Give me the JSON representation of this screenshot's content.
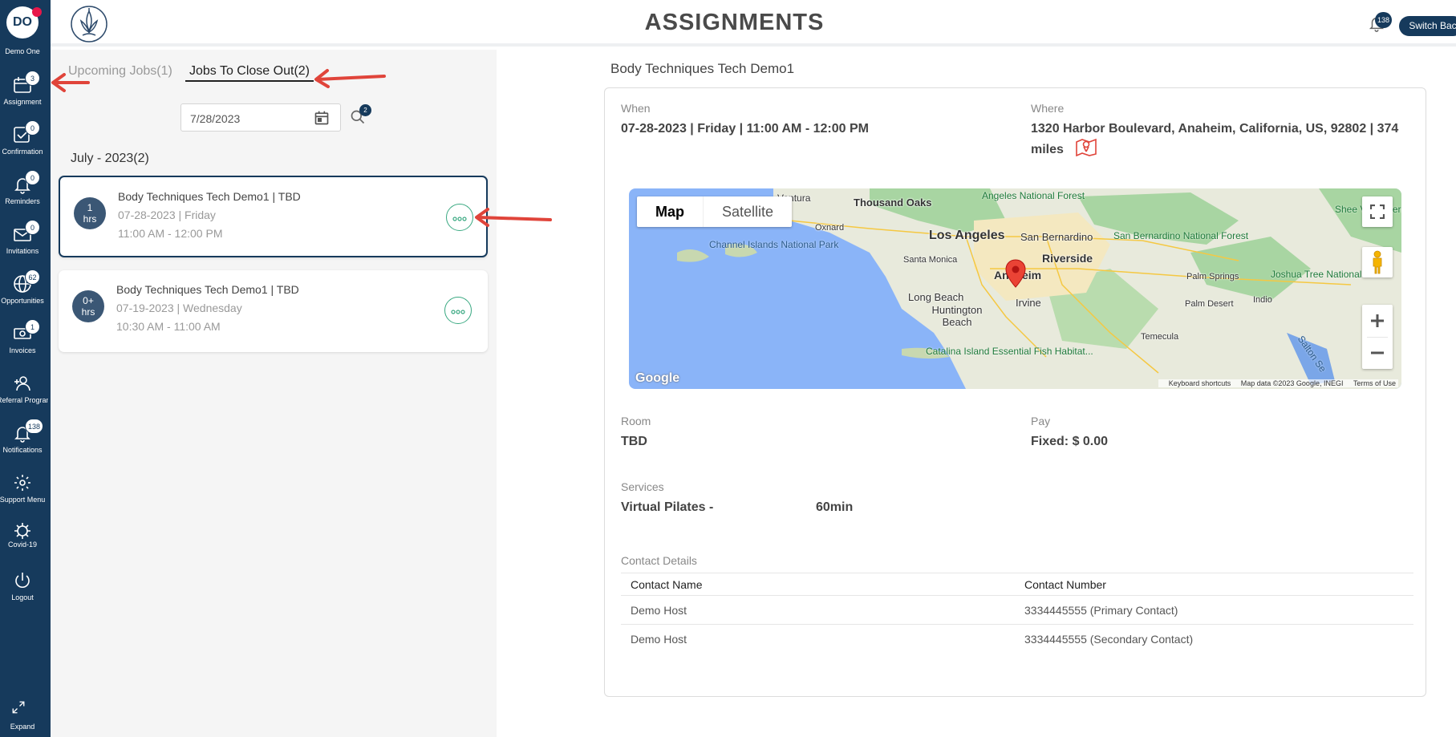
{
  "sidebar": {
    "avatar_initials": "DO",
    "user_name": "Demo One",
    "items": [
      {
        "label": "Assignment",
        "badge": "3",
        "icon": "calendar-icon"
      },
      {
        "label": "Confirmation",
        "badge": "0",
        "icon": "checkbox-icon"
      },
      {
        "label": "Reminders",
        "badge": "0",
        "icon": "bell-icon"
      },
      {
        "label": "Invitations",
        "badge": "0",
        "icon": "envelope-icon"
      },
      {
        "label": "Opportunities",
        "badge": "62",
        "icon": "globe-icon"
      },
      {
        "label": "Invoices",
        "badge": "1",
        "icon": "money-icon"
      },
      {
        "label": "Referral Program",
        "badge": "",
        "icon": "add-user-icon"
      },
      {
        "label": "Notifications",
        "badge": "138",
        "icon": "bell-icon"
      },
      {
        "label": "Support Menu",
        "badge": "",
        "icon": "gear-icon"
      },
      {
        "label": "Covid-19",
        "badge": "",
        "icon": "virus-icon"
      },
      {
        "label": "Logout",
        "badge": "",
        "icon": "power-icon"
      }
    ],
    "expand_label": "Expand"
  },
  "header": {
    "title": "ASSIGNMENTS",
    "notification_count": "138",
    "switch_back_label": "Switch Back"
  },
  "jobs_panel": {
    "tabs": [
      {
        "label": "Upcoming Jobs(1)",
        "active": false
      },
      {
        "label": "Jobs To Close Out(2)",
        "active": true
      }
    ],
    "date_filter": "7/28/2023",
    "search_badge": "2",
    "month_heading": "July - 2023(2)",
    "jobs": [
      {
        "duration_top": "1",
        "duration_bottom": "hrs",
        "title": "Body Techniques Tech Demo1 | TBD",
        "date": "07-28-2023 | Friday",
        "time": "11:00 AM - 12:00 PM",
        "selected": true
      },
      {
        "duration_top": "0+",
        "duration_bottom": "hrs",
        "title": "Body Techniques Tech Demo1 | TBD",
        "date": "07-19-2023 | Wednesday",
        "time": "10:30 AM - 11:00 AM",
        "selected": false
      }
    ]
  },
  "detail": {
    "title": "Body Techniques Tech Demo1",
    "when_label": "When",
    "when_value": "07-28-2023 | Friday | 11:00 AM - 12:00 PM",
    "where_label": "Where",
    "where_value": "1320 Harbor Boulevard, Anaheim, California, US, 92802 | 374 miles",
    "room_label": "Room",
    "room_value": "TBD",
    "pay_label": "Pay",
    "pay_value": "Fixed: $ 0.00",
    "services_label": "Services",
    "service_name": "Virtual Pilates -",
    "service_duration": "60min",
    "contact_label": "Contact Details",
    "contact_headers": [
      "Contact Name",
      "Contact Number"
    ],
    "contacts": [
      {
        "name": "Demo Host",
        "number": "3334445555 (Primary Contact)"
      },
      {
        "name": "Demo Host",
        "number": "3334445555 (Secondary Contact)"
      }
    ]
  },
  "map": {
    "type_options": [
      "Map",
      "Satellite"
    ],
    "selected_type": "Map",
    "footer": [
      "Keyboard shortcuts",
      "Map data ©2023 Google, INEGI",
      "Terms of Use"
    ],
    "logo_text": "Google",
    "places": {
      "ventura": "Ventura",
      "thousand_oaks": "Thousand Oaks",
      "oxnard": "Oxnard",
      "angeles_forest": "Angeles National Forest",
      "los_angeles": "Los Angeles",
      "san_bernardino": "San Bernardino",
      "sb_forest": "San Bernardino National Forest",
      "riverside": "Riverside",
      "santa_monica": "Santa Monica",
      "anaheim": "Anaheim",
      "channel_islands": "Channel Islands National Park",
      "long_beach": "Long Beach",
      "huntington_beach": "Huntington Beach",
      "irvine": "Irvine",
      "palm_springs": "Palm Springs",
      "joshua_tree": "Joshua Tree National Park",
      "palm_desert": "Palm Desert",
      "indio": "Indio",
      "temecula": "Temecula",
      "catalina": "Catalina Island Essential Fish Habitat...",
      "salton": "Salton Se",
      "sheep": "Shee Va Wilderness"
    },
    "colors": {
      "water": "#8ab4f8",
      "land": "#e8eadc",
      "park": "#a8d5a2",
      "marker": "#ea4335"
    }
  },
  "colors": {
    "sidebar": "#163a5c",
    "accent": "#3aa982",
    "badge_red": "#e8174a",
    "annotation_arrow": "#e0443a"
  }
}
